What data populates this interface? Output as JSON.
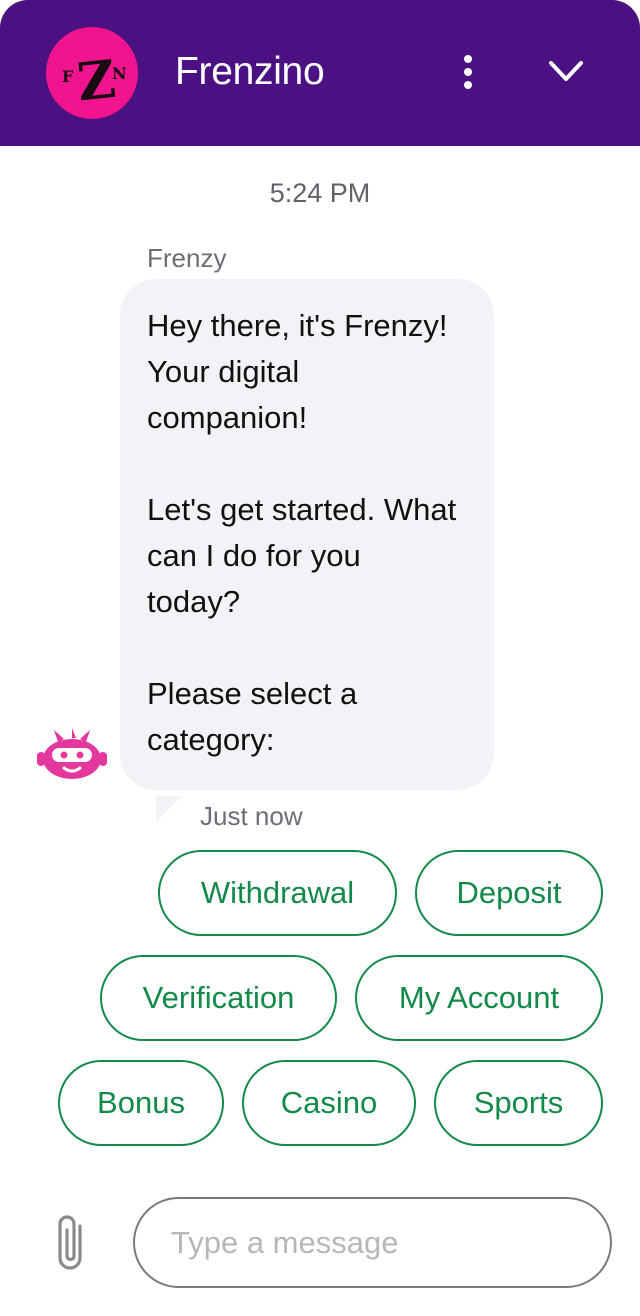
{
  "header": {
    "title": "Frenzino",
    "logo_text": "FZN",
    "logo_color": "#f0158f",
    "background_color": "#4b1183",
    "menu_icon": "vertical-dots-icon",
    "collapse_icon": "chevron-down-icon"
  },
  "conversation": {
    "timestamp": "5:24 PM",
    "messages": [
      {
        "sender": "Frenzy",
        "text": "Hey there, it's Frenzy!\nYour digital\ncompanion!\n\nLet's get started. What\ncan I do for you\ntoday?\n\nPlease select a\ncategory:",
        "time": "Just now",
        "avatar_icon": "robot-avatar-icon"
      }
    ]
  },
  "quick_replies": [
    {
      "label": "Withdrawal"
    },
    {
      "label": "Deposit"
    },
    {
      "label": "Verification"
    },
    {
      "label": "My Account"
    },
    {
      "label": "Bonus"
    },
    {
      "label": "Casino"
    },
    {
      "label": "Sports"
    }
  ],
  "composer": {
    "placeholder": "Type a message",
    "value": "",
    "attach_icon": "paperclip-icon"
  },
  "colors": {
    "accent": "#138a4a",
    "bubble": "#f1f3f6",
    "bot_pink": "#f0158f"
  }
}
